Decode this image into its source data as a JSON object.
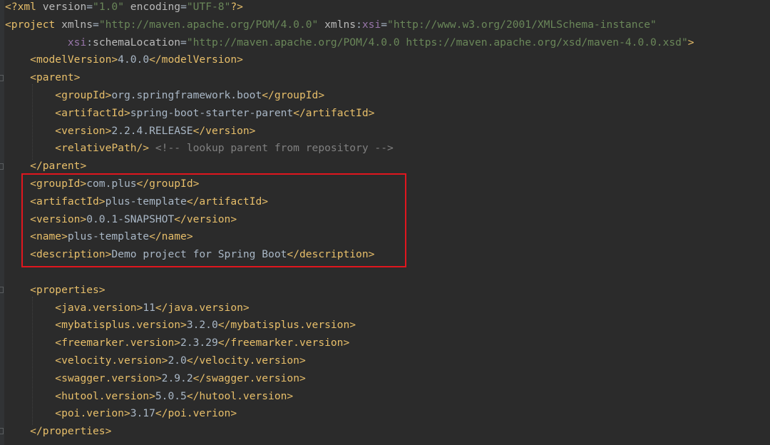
{
  "editor": {
    "theme_colors": {
      "background": "#2b2b2b",
      "tag": "#e8bf6a",
      "attribute": "#bababa",
      "namespace": "#9876aa",
      "value": "#6a8759",
      "comment": "#808080",
      "text": "#a9b7c6",
      "highlight_box": "#e0161e"
    },
    "lines": [
      [
        [
          "t",
          "<?"
        ],
        [
          "t",
          "xml "
        ],
        [
          "a",
          "version"
        ],
        [
          "x",
          "="
        ],
        [
          "v",
          "\"1.0\""
        ],
        [
          "x",
          " "
        ],
        [
          "a",
          "encoding"
        ],
        [
          "x",
          "="
        ],
        [
          "v",
          "\"UTF-8\""
        ],
        [
          "t",
          "?>"
        ]
      ],
      [
        [
          "t",
          "<project "
        ],
        [
          "a",
          "xmlns"
        ],
        [
          "x",
          "="
        ],
        [
          "v",
          "\"http://maven.apache.org/POM/4.0.0\""
        ],
        [
          "x",
          " "
        ],
        [
          "a",
          "xmlns"
        ],
        [
          "x",
          ":"
        ],
        [
          "ns",
          "xsi"
        ],
        [
          "x",
          "="
        ],
        [
          "v",
          "\"http://www.w3.org/2001/XMLSchema-instance\""
        ]
      ],
      [
        [
          "x",
          "          "
        ],
        [
          "ns",
          "xsi"
        ],
        [
          "x",
          ":"
        ],
        [
          "a",
          "schemaLocation"
        ],
        [
          "x",
          "="
        ],
        [
          "v",
          "\"http://maven.apache.org/POM/4.0.0 https://maven.apache.org/xsd/maven-4.0.0.xsd\""
        ],
        [
          "t",
          ">"
        ]
      ],
      [
        [
          "x",
          "    "
        ],
        [
          "t",
          "<modelVersion>"
        ],
        [
          "x",
          "4.0.0"
        ],
        [
          "t",
          "</modelVersion>"
        ]
      ],
      [
        [
          "x",
          "    "
        ],
        [
          "t",
          "<parent>"
        ]
      ],
      [
        [
          "x",
          "        "
        ],
        [
          "t",
          "<groupId>"
        ],
        [
          "x",
          "org.springframework.boot"
        ],
        [
          "t",
          "</groupId>"
        ]
      ],
      [
        [
          "x",
          "        "
        ],
        [
          "t",
          "<artifactId>"
        ],
        [
          "x",
          "spring-boot-starter-parent"
        ],
        [
          "t",
          "</artifactId>"
        ]
      ],
      [
        [
          "x",
          "        "
        ],
        [
          "t",
          "<version>"
        ],
        [
          "x",
          "2.2.4.RELEASE"
        ],
        [
          "t",
          "</version>"
        ]
      ],
      [
        [
          "x",
          "        "
        ],
        [
          "t",
          "<relativePath/>"
        ],
        [
          "x",
          " "
        ],
        [
          "c",
          "<!-- lookup parent from repository -->"
        ]
      ],
      [
        [
          "x",
          "    "
        ],
        [
          "t",
          "</parent>"
        ]
      ],
      [
        [
          "x",
          "    "
        ],
        [
          "t",
          "<groupId>"
        ],
        [
          "x",
          "com.plus"
        ],
        [
          "t",
          "</groupId>"
        ]
      ],
      [
        [
          "x",
          "    "
        ],
        [
          "t",
          "<artifactId>"
        ],
        [
          "x",
          "plus-template"
        ],
        [
          "t",
          "</artifactId>"
        ]
      ],
      [
        [
          "x",
          "    "
        ],
        [
          "t",
          "<version>"
        ],
        [
          "x",
          "0.0.1-SNAPSHOT"
        ],
        [
          "t",
          "</version>"
        ]
      ],
      [
        [
          "x",
          "    "
        ],
        [
          "t",
          "<name>"
        ],
        [
          "x",
          "plus-template"
        ],
        [
          "t",
          "</name>"
        ]
      ],
      [
        [
          "x",
          "    "
        ],
        [
          "t",
          "<description>"
        ],
        [
          "x",
          "Demo project for Spring Boot"
        ],
        [
          "t",
          "</description>"
        ]
      ],
      [],
      [
        [
          "x",
          "    "
        ],
        [
          "t",
          "<properties>"
        ]
      ],
      [
        [
          "x",
          "        "
        ],
        [
          "t",
          "<java.version>"
        ],
        [
          "x",
          "11"
        ],
        [
          "t",
          "</java.version>"
        ]
      ],
      [
        [
          "x",
          "        "
        ],
        [
          "t",
          "<mybatisplus.version>"
        ],
        [
          "x",
          "3.2.0"
        ],
        [
          "t",
          "</mybatisplus.version>"
        ]
      ],
      [
        [
          "x",
          "        "
        ],
        [
          "t",
          "<freemarker.version>"
        ],
        [
          "x",
          "2.3.29"
        ],
        [
          "t",
          "</freemarker.version>"
        ]
      ],
      [
        [
          "x",
          "        "
        ],
        [
          "t",
          "<velocity.version>"
        ],
        [
          "x",
          "2.0"
        ],
        [
          "t",
          "</velocity.version>"
        ]
      ],
      [
        [
          "x",
          "        "
        ],
        [
          "t",
          "<swagger.version>"
        ],
        [
          "x",
          "2.9.2"
        ],
        [
          "t",
          "</swagger.version>"
        ]
      ],
      [
        [
          "x",
          "        "
        ],
        [
          "t",
          "<hutool.version>"
        ],
        [
          "x",
          "5.0.5"
        ],
        [
          "t",
          "</hutool.version>"
        ]
      ],
      [
        [
          "x",
          "        "
        ],
        [
          "t",
          "<poi.verion>"
        ],
        [
          "x",
          "3.17"
        ],
        [
          "t",
          "</poi.verion>"
        ]
      ],
      [
        [
          "x",
          "    "
        ],
        [
          "t",
          "</properties>"
        ]
      ]
    ]
  }
}
